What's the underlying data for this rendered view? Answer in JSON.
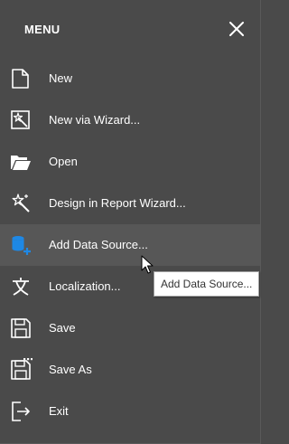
{
  "menu": {
    "title": "MENU",
    "close_icon": "close-icon",
    "items": [
      {
        "label": "New",
        "icon": "new-file-icon"
      },
      {
        "label": "New via Wizard...",
        "icon": "wizard-page-icon"
      },
      {
        "label": "Open",
        "icon": "open-folder-icon"
      },
      {
        "label": "Design in Report Wizard...",
        "icon": "magic-wand-icon"
      },
      {
        "label": "Add Data Source...",
        "icon": "add-database-icon",
        "state": "hovered"
      },
      {
        "label": "Localization...",
        "icon": "localization-icon"
      },
      {
        "label": "Save",
        "icon": "save-icon"
      },
      {
        "label": "Save As",
        "icon": "save-as-icon"
      },
      {
        "label": "Exit",
        "icon": "exit-icon"
      }
    ]
  },
  "tooltip": {
    "text": "Add Data Source..."
  },
  "colors": {
    "background": "#4a4a4a",
    "hover": "#575757",
    "text": "#ffffff",
    "accent_blue": "#1e88e5",
    "tooltip_bg": "#ffffff",
    "tooltip_text": "#333333"
  }
}
